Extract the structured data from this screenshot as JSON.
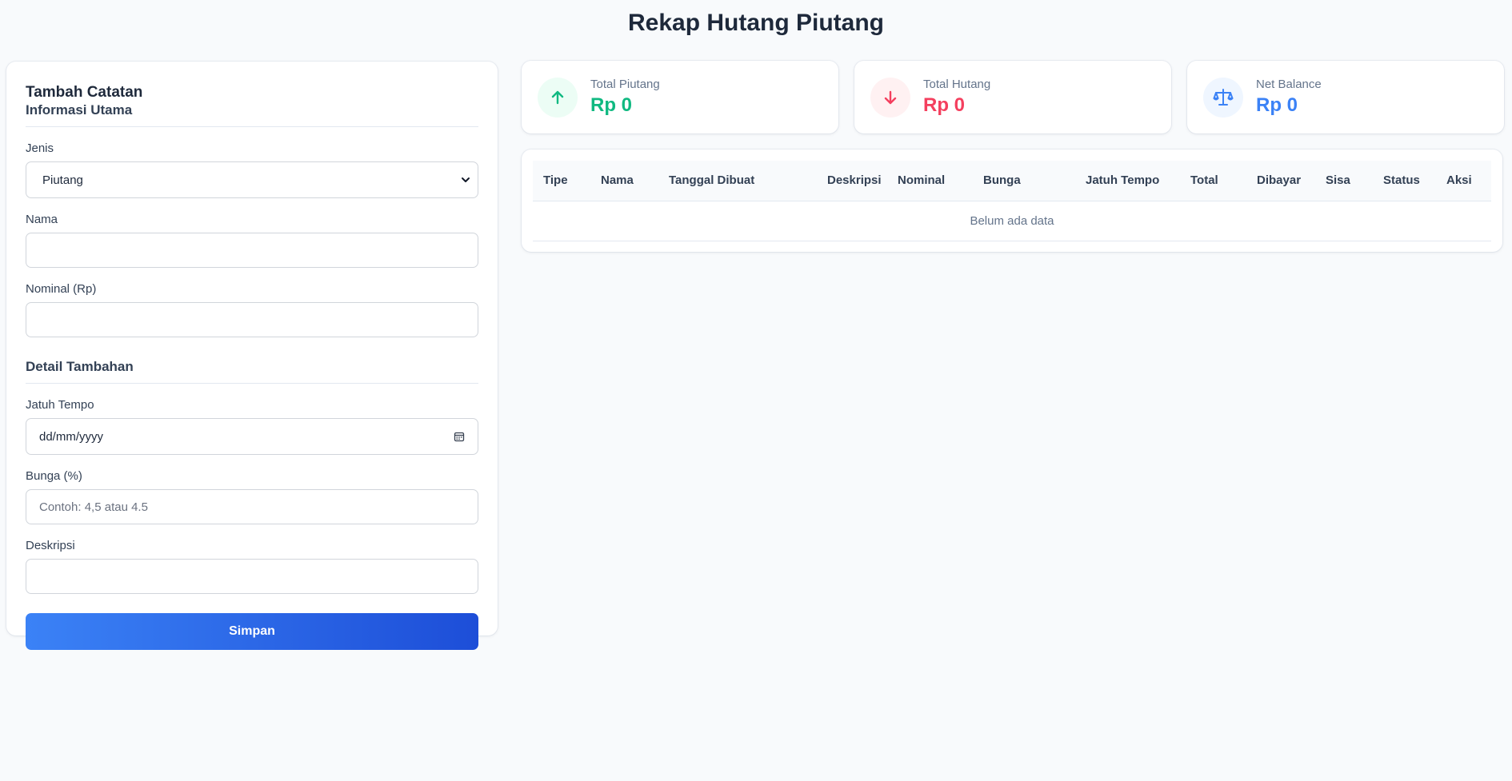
{
  "page": {
    "title": "Rekap Hutang Piutang"
  },
  "form": {
    "title": "Tambah Catatan",
    "section_main": "Informasi Utama",
    "jenis_label": "Jenis",
    "jenis_value": "Piutang",
    "nama_label": "Nama",
    "nama_value": "",
    "nominal_label": "Nominal (Rp)",
    "nominal_value": "",
    "section_detail": "Detail Tambahan",
    "jatuh_tempo_label": "Jatuh Tempo",
    "jatuh_tempo_placeholder": "dd/mm/yyyy",
    "bunga_label": "Bunga (%)",
    "bunga_placeholder": "Contoh: 4,5 atau 4.5",
    "deskripsi_label": "Deskripsi",
    "deskripsi_value": "",
    "save_label": "Simpan"
  },
  "stats": {
    "piutang": {
      "label": "Total Piutang",
      "value": "Rp 0",
      "icon": "arrow-up-icon",
      "color": "#10b981",
      "bg": "#ecfdf5"
    },
    "hutang": {
      "label": "Total Hutang",
      "value": "Rp 0",
      "icon": "arrow-down-icon",
      "color": "#f43f5e",
      "bg": "#fff1f2"
    },
    "net": {
      "label": "Net Balance",
      "value": "Rp 0",
      "icon": "scale-icon",
      "color": "#3b82f6",
      "bg": "#eff6ff"
    }
  },
  "table": {
    "columns": [
      "Tipe",
      "Nama",
      "Tanggal Dibuat",
      "Deskripsi",
      "Nominal",
      "Bunga",
      "Jatuh Tempo",
      "Total",
      "Dibayar",
      "Sisa",
      "Status",
      "Aksi"
    ],
    "empty_text": "Belum ada data"
  },
  "colors": {
    "accent": "#3b82f6",
    "accent_dark": "#1d4ed8",
    "background": "#f8fafc"
  }
}
